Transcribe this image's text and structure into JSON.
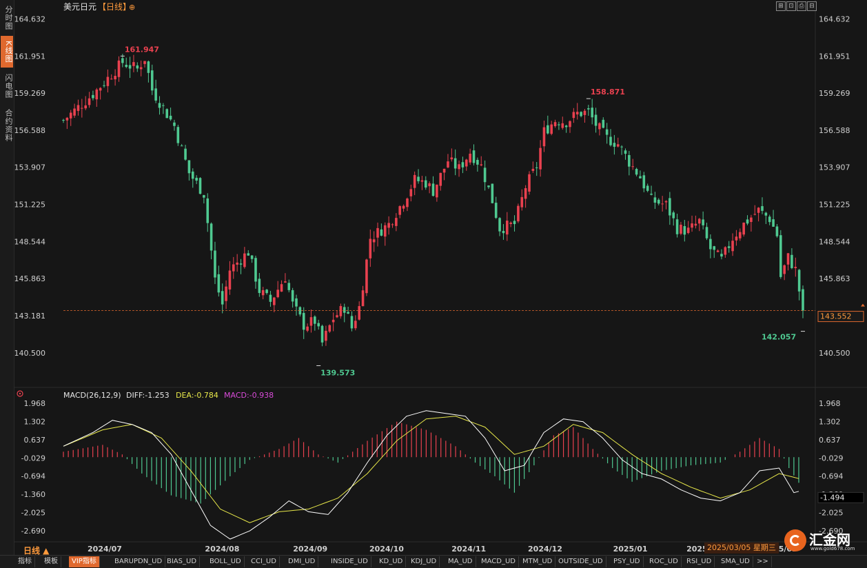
{
  "sidebar": {
    "items": [
      "分时图",
      "K线图",
      "闪电图",
      "合约资料"
    ],
    "active_index": 1
  },
  "header": {
    "symbol": "美元日元",
    "period": "【日线】",
    "plus_icon": "⊕"
  },
  "toolbar": [
    "⊞",
    "⊡",
    "⎙",
    "⊟"
  ],
  "period_selector": "日线 ▲",
  "date_readout": "2025/03/05 星期三",
  "logo": {
    "brand": "汇金网",
    "site": "www.gold678.com"
  },
  "bottom_tabs": [
    "指标",
    "模板",
    "VIP指标",
    "BARUPDN_UD",
    "BIAS_UD",
    "BOLL_UD",
    "CCI_UD",
    "DMI_UD",
    "INSIDE_UD",
    "KD_UD",
    "KDJ_UD",
    "MA_UD",
    "MACD_UD",
    "MTM_UD",
    "OUTSIDE_UD",
    "PSY_UD",
    "ROC_UD",
    "RSI_UD",
    "SMA_UD",
    ">>"
  ],
  "colors": {
    "up": "#e9414f",
    "down": "#4fc991",
    "diff": "#ffffff",
    "dea": "#e8e84a",
    "macd_label": "#d94bd9",
    "accent": "#ff9a3c"
  },
  "chart_data": [
    {
      "type": "candlestick",
      "ylim": [
        138.6,
        165.6
      ],
      "y_ticks": [
        164.632,
        161.951,
        159.269,
        156.588,
        153.907,
        151.225,
        148.544,
        145.863,
        143.181,
        140.5
      ],
      "x_ticks": [
        "2024/07",
        "2024/08",
        "2024/09",
        "2024/10",
        "2024/11",
        "2024/12",
        "2025/01",
        "2025/02",
        "2025/03"
      ],
      "annotations": [
        {
          "label": "161.947",
          "value": 161.947,
          "type": "high"
        },
        {
          "label": "158.871",
          "value": 158.871,
          "type": "high"
        },
        {
          "label": "139.573",
          "value": 139.573,
          "type": "low"
        },
        {
          "label": "142.057",
          "value": 142.057,
          "type": "low"
        }
      ],
      "last_price": {
        "label": "143.552",
        "value": 143.552
      },
      "close_path": [
        [
          0,
          157.3
        ],
        [
          8,
          159.2
        ],
        [
          16,
          161.5
        ],
        [
          20,
          161.0
        ],
        [
          22,
          161.8
        ],
        [
          24,
          159.5
        ],
        [
          30,
          156.9
        ],
        [
          34,
          153.5
        ],
        [
          38,
          152.0
        ],
        [
          41,
          145.8
        ],
        [
          43,
          144.0
        ],
        [
          45,
          146.5
        ],
        [
          50,
          147.8
        ],
        [
          53,
          145.0
        ],
        [
          56,
          144.2
        ],
        [
          60,
          146.0
        ],
        [
          62,
          144.0
        ],
        [
          65,
          142.5
        ],
        [
          68,
          142.8
        ],
        [
          70,
          141.2
        ],
        [
          73,
          143.0
        ],
        [
          76,
          143.8
        ],
        [
          78,
          142.3
        ],
        [
          80,
          143.8
        ],
        [
          83,
          148.8
        ],
        [
          88,
          149.8
        ],
        [
          92,
          151.5
        ],
        [
          95,
          153.0
        ],
        [
          98,
          152.8
        ],
        [
          100,
          152.2
        ],
        [
          104,
          154.4
        ],
        [
          107,
          153.8
        ],
        [
          110,
          155.0
        ],
        [
          113,
          154.0
        ],
        [
          116,
          151.5
        ],
        [
          118,
          149.5
        ],
        [
          122,
          149.8
        ],
        [
          125,
          152.5
        ],
        [
          128,
          154.0
        ],
        [
          130,
          156.5
        ],
        [
          133,
          157.3
        ],
        [
          136,
          157.2
        ],
        [
          139,
          157.8
        ],
        [
          142,
          157.9
        ],
        [
          144,
          157.0
        ],
        [
          147,
          156.0
        ],
        [
          150,
          155.6
        ],
        [
          153,
          154.3
        ],
        [
          156,
          153.2
        ],
        [
          159,
          151.5
        ],
        [
          163,
          151.2
        ],
        [
          166,
          149.5
        ],
        [
          169,
          149.3
        ],
        [
          172,
          150.0
        ],
        [
          175,
          148.0
        ],
        [
          178,
          147.2
        ],
        [
          181,
          148.8
        ],
        [
          184,
          149.8
        ],
        [
          188,
          150.8
        ],
        [
          191,
          150.2
        ],
        [
          193,
          149.0
        ],
        [
          194,
          146.0
        ],
        [
          196,
          147.4
        ],
        [
          198,
          146.5
        ],
        [
          200,
          143.5
        ]
      ]
    },
    {
      "type": "macd",
      "title": "MACD(26,12,9)",
      "values": {
        "DIFF": "-1.253",
        "DEA": "-0.784",
        "MACD": "-0.938"
      },
      "legend_labels": {
        "DIFF": "DIFF:-1.253",
        "DEA": "DEA:-0.784",
        "MACD": "MACD:-0.938"
      },
      "ylim": [
        -3.1,
        2.1
      ],
      "y_ticks": [
        1.968,
        1.302,
        0.637,
        -0.029,
        -0.694,
        -1.36,
        -2.025,
        -2.69
      ],
      "last_value_label": "-1.494",
      "diff_path": [
        [
          0,
          0.4
        ],
        [
          6,
          0.9
        ],
        [
          10,
          1.35
        ],
        [
          14,
          1.2
        ],
        [
          18,
          0.9
        ],
        [
          22,
          0.1
        ],
        [
          26,
          -1.2
        ],
        [
          30,
          -2.5
        ],
        [
          34,
          -3.0
        ],
        [
          38,
          -2.7
        ],
        [
          42,
          -2.2
        ],
        [
          46,
          -1.6
        ],
        [
          50,
          -2.0
        ],
        [
          54,
          -2.1
        ],
        [
          58,
          -1.3
        ],
        [
          62,
          -0.2
        ],
        [
          66,
          0.8
        ],
        [
          70,
          1.5
        ],
        [
          74,
          1.7
        ],
        [
          78,
          1.6
        ],
        [
          82,
          1.5
        ],
        [
          86,
          0.7
        ],
        [
          90,
          -0.5
        ],
        [
          94,
          -0.3
        ],
        [
          98,
          0.9
        ],
        [
          102,
          1.4
        ],
        [
          106,
          1.3
        ],
        [
          110,
          0.7
        ],
        [
          114,
          -0.1
        ],
        [
          118,
          -0.6
        ],
        [
          122,
          -0.8
        ],
        [
          126,
          -1.2
        ],
        [
          130,
          -1.5
        ],
        [
          134,
          -1.6
        ],
        [
          138,
          -1.3
        ],
        [
          142,
          -0.5
        ],
        [
          146,
          -0.4
        ],
        [
          149,
          -1.3
        ],
        [
          150,
          -1.253
        ]
      ],
      "dea_path": [
        [
          0,
          0.4
        ],
        [
          8,
          1.0
        ],
        [
          14,
          1.2
        ],
        [
          20,
          0.7
        ],
        [
          26,
          -0.5
        ],
        [
          32,
          -1.9
        ],
        [
          38,
          -2.4
        ],
        [
          44,
          -2.0
        ],
        [
          50,
          -1.9
        ],
        [
          56,
          -1.5
        ],
        [
          62,
          -0.6
        ],
        [
          68,
          0.6
        ],
        [
          74,
          1.4
        ],
        [
          80,
          1.5
        ],
        [
          86,
          1.1
        ],
        [
          92,
          0.1
        ],
        [
          98,
          0.4
        ],
        [
          104,
          1.2
        ],
        [
          110,
          0.9
        ],
        [
          116,
          0.1
        ],
        [
          122,
          -0.6
        ],
        [
          128,
          -1.1
        ],
        [
          134,
          -1.5
        ],
        [
          140,
          -1.2
        ],
        [
          146,
          -0.6
        ],
        [
          150,
          -0.784
        ]
      ],
      "histogram_path": [
        [
          0,
          0.2
        ],
        [
          8,
          0.45
        ],
        [
          12,
          0.1
        ],
        [
          16,
          -0.6
        ],
        [
          22,
          -1.4
        ],
        [
          28,
          -1.7
        ],
        [
          34,
          -0.7
        ],
        [
          38,
          -0.1
        ],
        [
          44,
          0.3
        ],
        [
          48,
          0.7
        ],
        [
          52,
          0.1
        ],
        [
          56,
          -0.2
        ],
        [
          62,
          0.6
        ],
        [
          68,
          1.3
        ],
        [
          74,
          1.0
        ],
        [
          80,
          0.4
        ],
        [
          84,
          -0.2
        ],
        [
          88,
          -0.7
        ],
        [
          92,
          -1.3
        ],
        [
          96,
          -0.3
        ],
        [
          100,
          0.8
        ],
        [
          104,
          1.1
        ],
        [
          108,
          0.3
        ],
        [
          112,
          -0.4
        ],
        [
          116,
          -0.9
        ],
        [
          122,
          -0.5
        ],
        [
          128,
          -0.3
        ],
        [
          134,
          -0.2
        ],
        [
          138,
          0.2
        ],
        [
          142,
          0.7
        ],
        [
          146,
          0.3
        ],
        [
          148,
          -0.4
        ],
        [
          150,
          -0.938
        ]
      ]
    }
  ]
}
